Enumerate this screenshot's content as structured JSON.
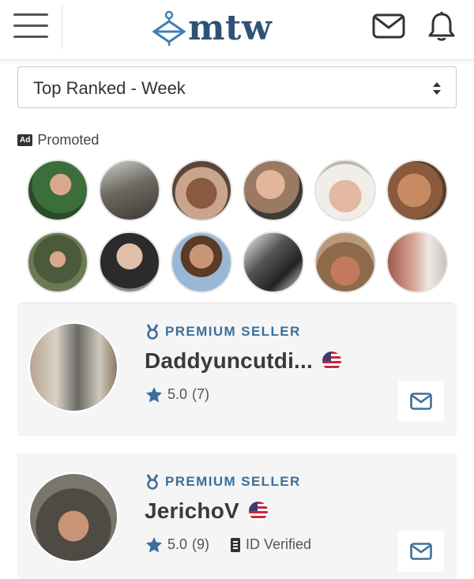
{
  "header": {
    "logo_text": "mtw",
    "icons": [
      "menu-icon",
      "hanger-logo-icon",
      "mail-icon",
      "bell-icon"
    ]
  },
  "sort": {
    "selected": "Top Ranked - Week"
  },
  "promoted": {
    "badge": "Ad",
    "label": "Promoted"
  },
  "colors": {
    "brand": "#2f5178",
    "accent": "#3d6e9c",
    "card_bg": "#f5f5f5"
  },
  "sellers": [
    {
      "badge": "PREMIUM SELLER",
      "name": "Daddyuncutdi...",
      "rating": "5.0",
      "reviews": "(7)",
      "verified": ""
    },
    {
      "badge": "PREMIUM SELLER",
      "name": "JerichoV",
      "rating": "5.0",
      "reviews": "(9)",
      "verified": "ID Verified"
    }
  ]
}
